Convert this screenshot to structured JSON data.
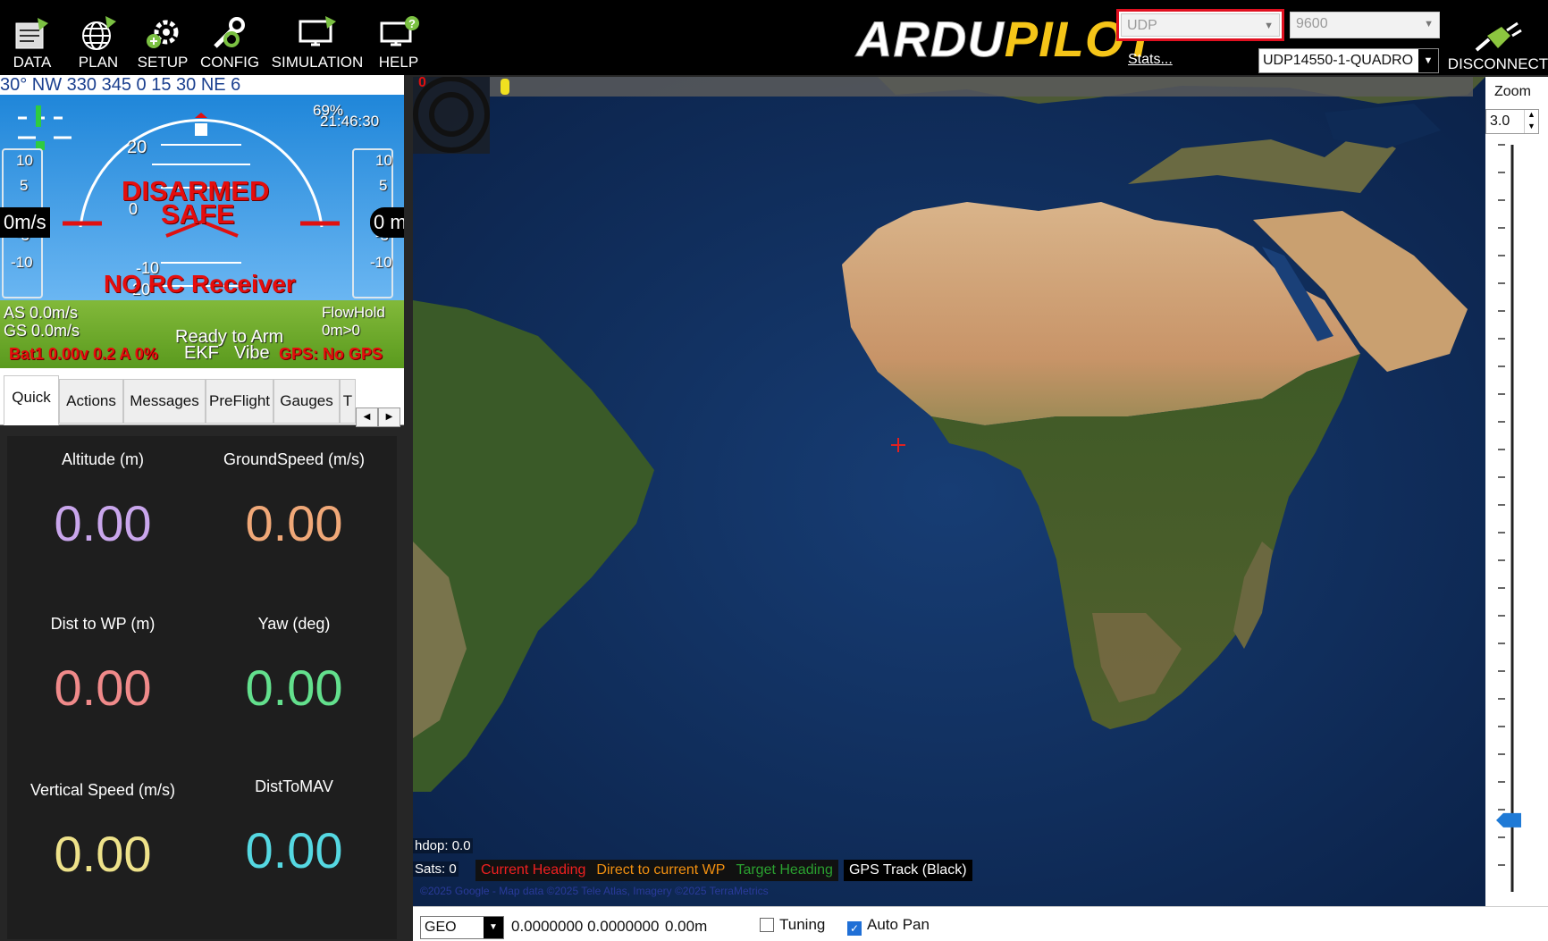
{
  "toolbar": {
    "data": "DATA",
    "plan": "PLAN",
    "setup": "SETUP",
    "config": "CONFIG",
    "simulation": "SIMULATION",
    "help": "HELP",
    "logo_a": "ARDU",
    "logo_b": "PILOT",
    "port": "UDP",
    "baud": "9600",
    "stats": "Stats...",
    "connection": "UDP14550-1-QUADRO",
    "disconnect": "DISCONNECT"
  },
  "hud": {
    "compass": "30° NW  330  345  0  15  30  NE  6",
    "pct": "69%",
    "clock": "21:46:30",
    "disarmed": "DISARMED",
    "safe": "SAFE",
    "no_rc": "NO RC Receiver",
    "left_speed": "0m/s",
    "right_alt": "0 m",
    "pitch_20": "20",
    "pitch_10": "10",
    "pitch_0": "0",
    "pitch_m10": "-10",
    "pitch_m20": "-20",
    "as": "AS 0.0m/s",
    "gs": "GS 0.0m/s",
    "mode": "FlowHold",
    "mode_sub": "0m>0",
    "ready": "Ready to Arm",
    "bat": "Bat1 0.00v 0.2 A 0%",
    "ekf": "EKF",
    "vibe": "Vibe",
    "gps": "GPS: No GPS",
    "tape_left": [
      "10",
      "5",
      "-5",
      "-10"
    ],
    "tape_right": [
      "10",
      "5",
      "-5",
      "-10"
    ]
  },
  "tabs": [
    "Quick",
    "Actions",
    "Messages",
    "PreFlight",
    "Gauges",
    "T"
  ],
  "quick": [
    {
      "label": "Altitude (m)",
      "value": "0.00",
      "color": "#c9a6ec"
    },
    {
      "label": "GroundSpeed (m/s)",
      "value": "0.00",
      "color": "#f0a878"
    },
    {
      "label": "Dist to WP (m)",
      "value": "0.00",
      "color": "#f08a8a"
    },
    {
      "label": "Yaw (deg)",
      "value": "0.00",
      "color": "#63e08d"
    },
    {
      "label": "Vertical Speed (m/s)",
      "value": "0.00",
      "color": "#eee28a"
    },
    {
      "label": "DistToMAV",
      "value": "0.00",
      "color": "#55d8e2"
    }
  ],
  "map": {
    "zero_label": "0",
    "hdop": "hdop: 0.0",
    "sats": "Sats: 0",
    "legend_current": "Current Heading",
    "legend_direct": "Direct to current WP",
    "legend_target": "Target Heading",
    "legend_gps": "GPS Track (Black)",
    "copyright": "©2025 Google - Map data ©2025 Tele Atlas, Imagery ©2025 TerraMetrics"
  },
  "zoom": {
    "label": "Zoom",
    "value": "3.0",
    "level_fraction": 0.06
  },
  "bottom": {
    "coord_system": "GEO",
    "coords": "0.0000000 0.0000000",
    "alt": "0.00m",
    "tuning": "Tuning",
    "autopan": "Auto Pan"
  }
}
